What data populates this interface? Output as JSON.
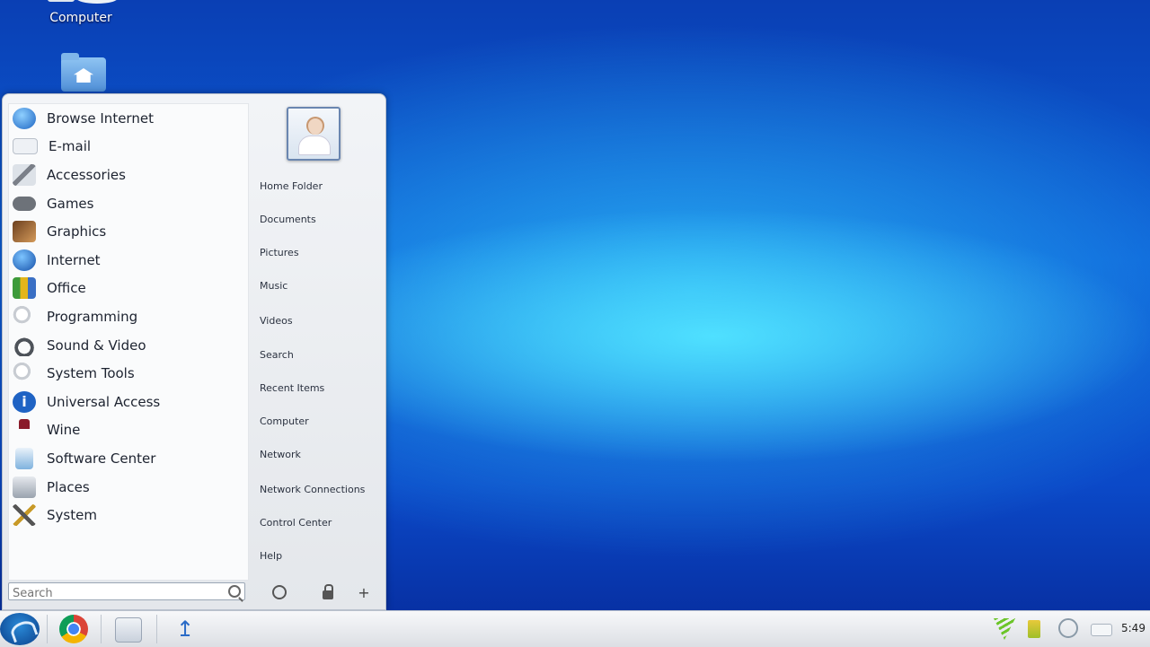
{
  "desktop": {
    "icons": [
      {
        "label": "Computer"
      },
      {
        "label": ""
      }
    ]
  },
  "menu": {
    "categories": [
      {
        "label": "Browse Internet",
        "icon": "globe-icon",
        "color": "#2a7fd4"
      },
      {
        "label": "E-mail",
        "icon": "envelope-icon",
        "color": "#c9ced6"
      },
      {
        "label": "Accessories",
        "icon": "accessories-icon",
        "color": "#8a8f98"
      },
      {
        "label": "Games",
        "icon": "gamepad-icon",
        "color": "#6d7279"
      },
      {
        "label": "Graphics",
        "icon": "graphics-icon",
        "color": "#a86a3a"
      },
      {
        "label": "Internet",
        "icon": "globe-icon",
        "color": "#1e6ac8"
      },
      {
        "label": "Office",
        "icon": "office-icon",
        "color": "#d4a017"
      },
      {
        "label": "Programming",
        "icon": "magnifier-icon",
        "color": "#c8ccd2"
      },
      {
        "label": "Sound & Video",
        "icon": "headphones-icon",
        "color": "#5a5f66"
      },
      {
        "label": "System Tools",
        "icon": "magnifier-icon",
        "color": "#c8ccd2"
      },
      {
        "label": "Universal Access",
        "icon": "info-icon",
        "color": "#1f63c4"
      },
      {
        "label": "Wine",
        "icon": "wine-glass-icon",
        "color": "#8a1b2a"
      },
      {
        "label": "Software Center",
        "icon": "software-center-icon",
        "color": "#4a90c8"
      },
      {
        "label": "Places",
        "icon": "places-icon",
        "color": "#9aa3ae"
      },
      {
        "label": "System",
        "icon": "tools-icon",
        "color": "#c89a28"
      }
    ],
    "places": [
      {
        "label": "Home Folder"
      },
      {
        "label": "Documents"
      },
      {
        "label": "Pictures"
      },
      {
        "label": "Music"
      },
      {
        "label": "Videos"
      },
      {
        "label": "Search"
      },
      {
        "label": "Recent Items"
      },
      {
        "label": "Computer"
      },
      {
        "label": "Network"
      },
      {
        "label": "Network Connections"
      },
      {
        "label": "Control Center"
      },
      {
        "label": "Help"
      }
    ],
    "search": {
      "placeholder": "Search",
      "value": ""
    },
    "actions": {
      "add_label": "+"
    }
  },
  "taskbar": {
    "clock": "5:49"
  }
}
